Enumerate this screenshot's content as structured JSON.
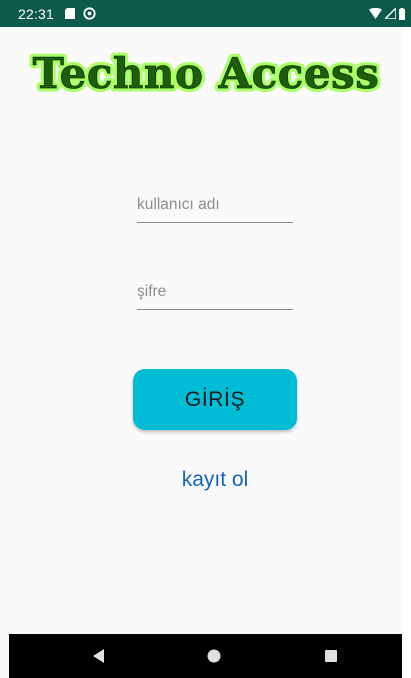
{
  "status_bar": {
    "time": "22:31",
    "background": "#0d5a4a",
    "icons": [
      "sd-card-icon",
      "sync-icon",
      "wifi-icon",
      "signal-icon",
      "battery-icon"
    ]
  },
  "app": {
    "title": "Techno Access",
    "title_color": "#1f5d0c",
    "title_glow_color": "#aaff66"
  },
  "form": {
    "username": {
      "placeholder": "kullanıcı adı",
      "value": ""
    },
    "password": {
      "placeholder": "şifre",
      "value": ""
    },
    "login_label": "GİRİŞ",
    "login_color": "#00bcd4",
    "register_label": "kayıt ol",
    "register_color": "#1565c0"
  },
  "nav_bar": {
    "icons": [
      "back-icon",
      "home-icon",
      "recent-apps-icon"
    ]
  }
}
